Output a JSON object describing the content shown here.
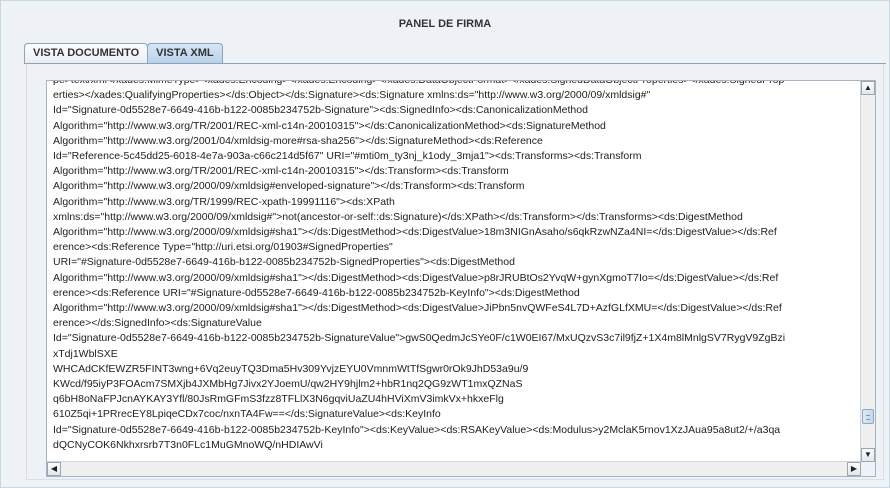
{
  "panel": {
    "title": "PANEL DE FIRMA"
  },
  "tabs": [
    {
      "label": "VISTA DOCUMENTO",
      "active": false
    },
    {
      "label": "VISTA XML",
      "active": true
    }
  ],
  "xml_lines": [
    "pe>text/xml</xades:MimeType><xades:Encoding></xades:Encoding></xades:DataObjectFormat></xades:SignedDataObjectProperties></xades:SignedProp",
    "erties></xades:QualifyingProperties></ds:Object></ds:Signature><ds:Signature xmlns:ds=\"http://www.w3.org/2000/09/xmldsig#\"",
    "Id=\"Signature-0d5528e7-6649-416b-b122-0085b234752b-Signature\"><ds:SignedInfo><ds:CanonicalizationMethod",
    "Algorithm=\"http://www.w3.org/TR/2001/REC-xml-c14n-20010315\"></ds:CanonicalizationMethod><ds:SignatureMethod",
    "Algorithm=\"http://www.w3.org/2001/04/xmldsig-more#rsa-sha256\"></ds:SignatureMethod><ds:Reference",
    "Id=\"Reference-5c45dd25-6018-4e7a-903a-c66c214d5f67\" URI=\"#mti0m_ty3nj_k1ody_3mja1\"><ds:Transforms><ds:Transform",
    "Algorithm=\"http://www.w3.org/TR/2001/REC-xml-c14n-20010315\"></ds:Transform><ds:Transform",
    "Algorithm=\"http://www.w3.org/2000/09/xmldsig#enveloped-signature\"></ds:Transform><ds:Transform",
    "Algorithm=\"http://www.w3.org/TR/1999/REC-xpath-19991116\"><ds:XPath",
    "xmlns:ds=\"http://www.w3.org/2000/09/xmldsig#\">not(ancestor-or-self::ds:Signature)</ds:XPath></ds:Transform></ds:Transforms><ds:DigestMethod",
    "Algorithm=\"http://www.w3.org/2000/09/xmldsig#sha1\"></ds:DigestMethod><ds:DigestValue>18m3NIGnAsaho/s6qkRzwNZa4NI=</ds:DigestValue></ds:Ref",
    "erence><ds:Reference Type=\"http://uri.etsi.org/01903#SignedProperties\"",
    "URI=\"#Signature-0d5528e7-6649-416b-b122-0085b234752b-SignedProperties\"><ds:DigestMethod",
    "Algorithm=\"http://www.w3.org/2000/09/xmldsig#sha1\"></ds:DigestMethod><ds:DigestValue>p8rJRUBtOs2YvqW+gynXgmoT7Io=</ds:DigestValue></ds:Ref",
    "erence><ds:Reference URI=\"#Signature-0d5528e7-6649-416b-b122-0085b234752b-KeyInfo\"><ds:DigestMethod",
    "Algorithm=\"http://www.w3.org/2000/09/xmldsig#sha1\"></ds:DigestMethod><ds:DigestValue>JiPbn5nvQWFeS4L7D+AzfGLfXMU=</ds:DigestValue></ds:Ref",
    "erence></ds:SignedInfo><ds:SignatureValue",
    "Id=\"Signature-0d5528e7-6649-416b-b122-0085b234752b-SignatureValue\">gwS0QedmJcSYe0F/c1W0EI67/MxUQzvS3c7il9fjZ+1X4m8lMnlgSV7RygV9ZgBzi",
    "xTdj1WblSXE",
    "WHCAdCKfEWZR5FINT3wng+6Vq2euyTQ3Dma5Hv309YvjzEYU0VmnmWtTfSgwr0rOk9JhD53a9u/9",
    "KWcd/f95iyP3FOAcm7SMXjb4JXMbHg7Jivx2YJoemU/qw2HY9hjlm2+hbR1nq2QG9zWT1mxQZNaS",
    "q6bH8oNaFPJcnAYKAY3Yfl/80JsRmGFmS3fzz8TFLlX3N6gqviUaZU4hHViXmV3imkVx+hkxeFlg",
    "610Z5qi+1PRrecEY8LpiqeCDx7coc/nxnTA4Fw==</ds:SignatureValue><ds:KeyInfo",
    "Id=\"Signature-0d5528e7-6649-416b-b122-0085b234752b-KeyInfo\"><ds:KeyValue><ds:RSAKeyValue><ds:Modulus>y2MclaK5rnov1XzJAua95a8ut2/+/a3qa",
    "dQCNyCOK6Nkhxrsrb7T3n0FLc1MuGMnoWQ/nHDIAwVi"
  ],
  "scrollbars": {
    "up_glyph": "▲",
    "down_glyph": "▼",
    "left_glyph": "◀",
    "right_glyph": "▶"
  }
}
